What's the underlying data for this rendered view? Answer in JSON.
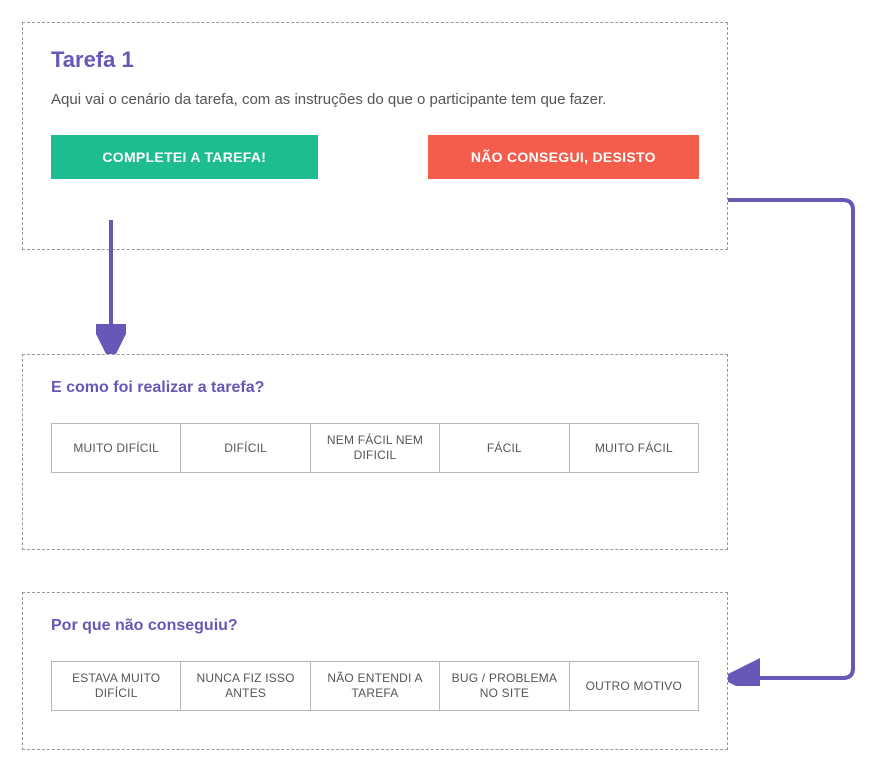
{
  "task": {
    "title": "Tarefa 1",
    "description": "Aqui vai o cenário da tarefa, com as instruções do que o participante tem que fazer.",
    "complete_label": "COMPLETEI A TAREFA!",
    "giveup_label": "NÃO CONSEGUI, DESISTO"
  },
  "difficulty": {
    "question": "E como foi realizar a tarefa?",
    "options": [
      "MUITO DIFÍCIL",
      "DIFÍCIL",
      "NEM FÁCIL NEM DIFICIL",
      "FÁCIL",
      "MUITO FÁCIL"
    ]
  },
  "reason": {
    "question": "Por que não conseguiu?",
    "options": [
      "ESTAVA MUITO DIFÍCIL",
      "NUNCA FIZ ISSO ANTES",
      "NÃO ENTENDI A TAREFA",
      "BUG / PROBLEMA NO SITE",
      "OUTRO MOTIVO"
    ]
  },
  "colors": {
    "accent": "#6957b8",
    "success": "#1ebd91",
    "danger": "#f45c4b"
  }
}
